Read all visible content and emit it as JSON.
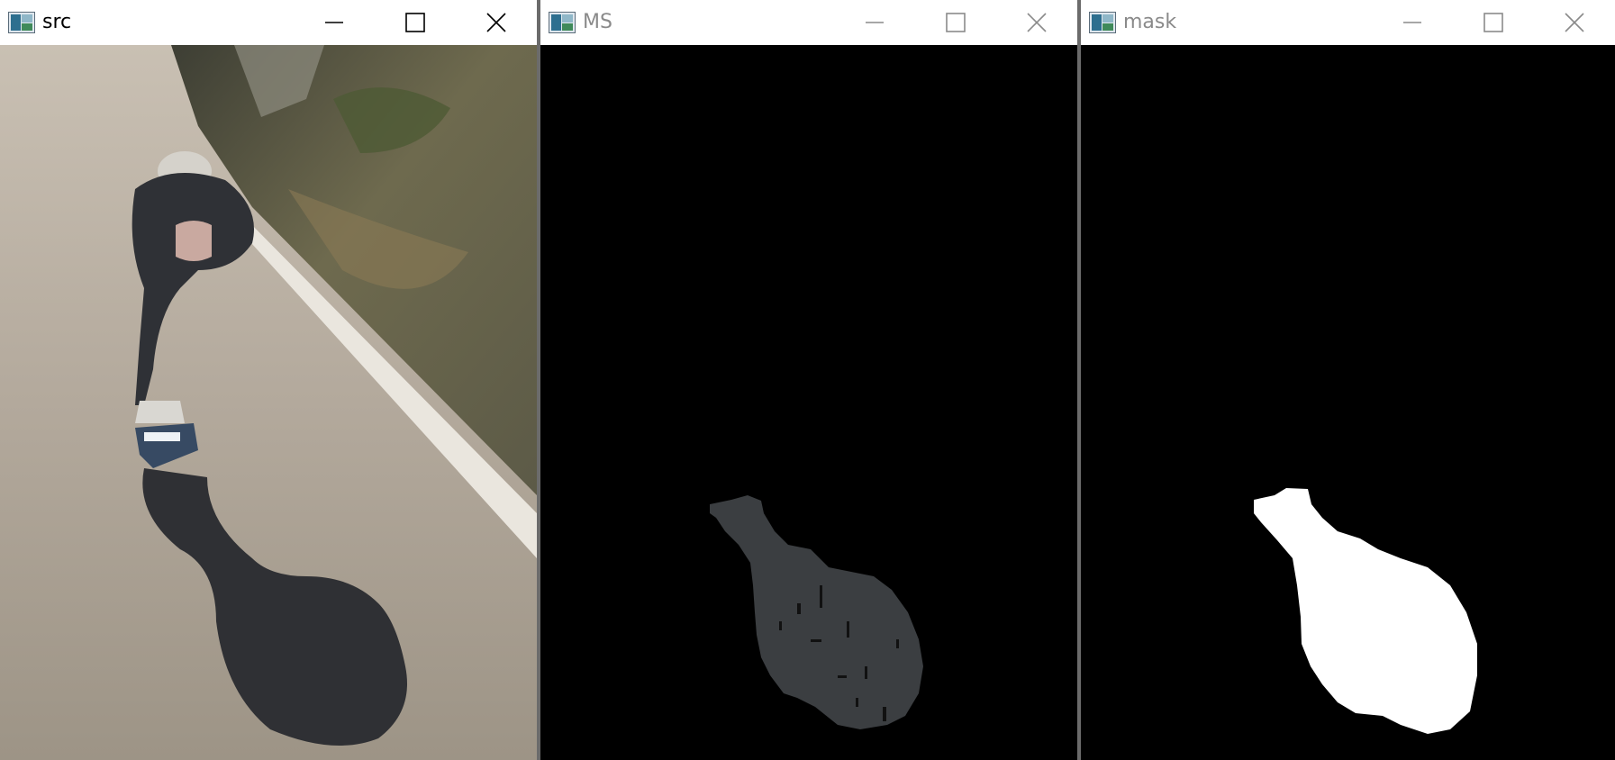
{
  "windows": [
    {
      "title": "src",
      "active": true
    },
    {
      "title": "MS",
      "active": false
    },
    {
      "title": "mask",
      "active": false
    }
  ],
  "icons": {
    "app": "image-viewer-icon",
    "minimize": "minimize-icon",
    "maximize": "maximize-icon",
    "close": "close-icon"
  },
  "colors": {
    "titlebar": "#ffffff",
    "canvas": "#000000",
    "ms_region": "#3b3e41",
    "mask_region": "#ffffff"
  }
}
